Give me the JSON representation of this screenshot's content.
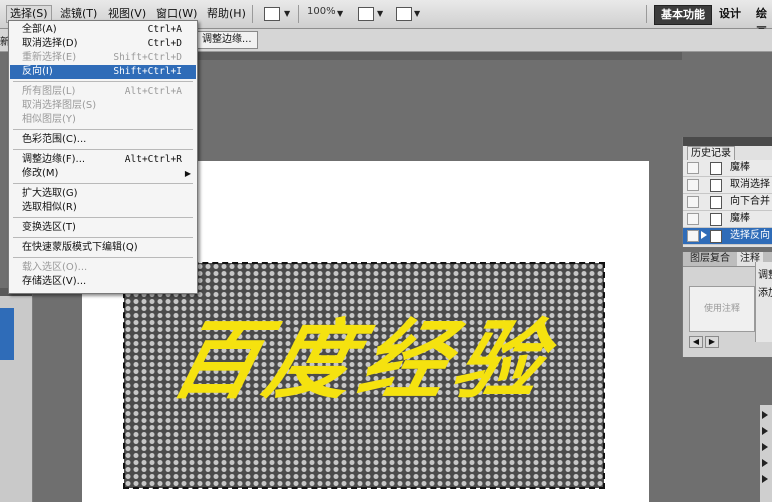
{
  "menubar": {
    "items": [
      {
        "label": "选择(S)"
      },
      {
        "label": "滤镜(T)"
      },
      {
        "label": "视图(V)"
      },
      {
        "label": "窗口(W)"
      },
      {
        "label": "帮助(H)"
      }
    ],
    "zoom": "100%",
    "workspaces": [
      "基本功能",
      "设计",
      "绘画"
    ]
  },
  "options_bar": {
    "left_fragment": "新",
    "refine_edge_label": "调整边缘..."
  },
  "select_menu": {
    "items": [
      {
        "label": "全部(A)",
        "shortcut": "Ctrl+A"
      },
      {
        "label": "取消选择(D)",
        "shortcut": "Ctrl+D"
      },
      {
        "label": "重新选择(E)",
        "shortcut": "Shift+Ctrl+D"
      },
      {
        "label": "反向(I)",
        "shortcut": "Shift+Ctrl+I"
      },
      {
        "label": "所有图层(L)",
        "shortcut": "Alt+Ctrl+A"
      },
      {
        "label": "取消选择图层(S)",
        "shortcut": ""
      },
      {
        "label": "相似图层(Y)",
        "shortcut": ""
      },
      {
        "label": "色彩范围(C)...",
        "shortcut": ""
      },
      {
        "label": "调整边缘(F)...",
        "shortcut": "Alt+Ctrl+R"
      },
      {
        "label": "修改(M)",
        "shortcut": ""
      },
      {
        "label": "扩大选取(G)",
        "shortcut": ""
      },
      {
        "label": "选取相似(R)",
        "shortcut": ""
      },
      {
        "label": "变换选区(T)",
        "shortcut": ""
      },
      {
        "label": "在快速蒙版模式下编辑(Q)",
        "shortcut": ""
      },
      {
        "label": "载入选区(O)...",
        "shortcut": ""
      },
      {
        "label": "存储选区(V)...",
        "shortcut": ""
      }
    ]
  },
  "history_panel": {
    "title": "历史记录",
    "rows": [
      {
        "label": "魔棒"
      },
      {
        "label": "取消选择"
      },
      {
        "label": "向下合并"
      },
      {
        "label": "魔棒"
      },
      {
        "label": "选择反向"
      }
    ]
  },
  "layers_panel": {
    "tabs": [
      "图层复合",
      "注释"
    ],
    "note_placeholder": "使用注释"
  },
  "adjust_panel": {
    "title": "调整",
    "add_label": "添加"
  },
  "canvas": {
    "logo_text": "百度经验"
  },
  "colors": {
    "highlight": "#2f6cb8",
    "logo_yellow": "#f5e20f"
  }
}
